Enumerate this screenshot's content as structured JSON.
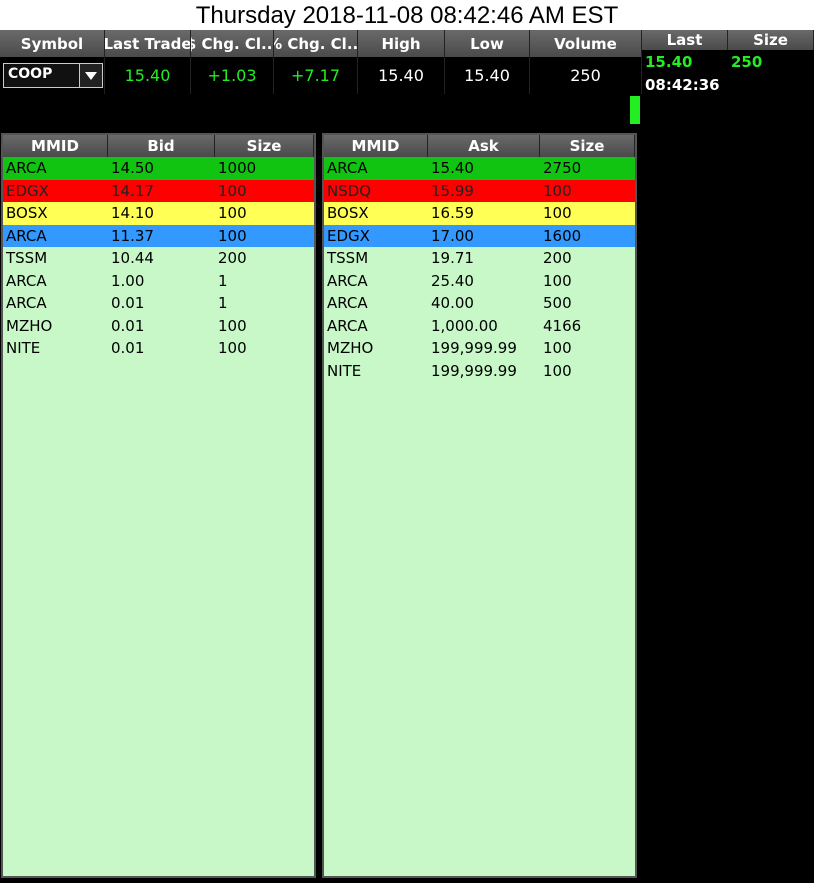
{
  "datetime": "Thursday 2018-11-08 08:42:46 AM EST",
  "quote": {
    "headers": [
      "Symbol",
      "Last Trade",
      "$ Chg. Cl...",
      "% Chg. Cl...",
      "High",
      "Low",
      "Volume"
    ],
    "symbol": "COOP",
    "last_trade": "15.40",
    "chg_dollar": "+1.03",
    "chg_pct": "+7.17",
    "high": "15.40",
    "low": "15.40",
    "volume": "250"
  },
  "time_sales": {
    "headers": [
      "Last",
      "Size"
    ],
    "last": "15.40",
    "size": "250",
    "time": "08:42:36"
  },
  "bid_book": {
    "headers": [
      "MMID",
      "Bid",
      "Size"
    ],
    "rows": [
      {
        "mmid": "ARCA",
        "price": "14.50",
        "size": "1000",
        "level": "lvl1"
      },
      {
        "mmid": "EDGX",
        "price": "14.17",
        "size": "100",
        "level": "lvl2"
      },
      {
        "mmid": "BOSX",
        "price": "14.10",
        "size": "100",
        "level": "lvl3"
      },
      {
        "mmid": "ARCA",
        "price": "11.37",
        "size": "100",
        "level": "lvl4"
      },
      {
        "mmid": "TSSM",
        "price": "10.44",
        "size": "200",
        "level": ""
      },
      {
        "mmid": "ARCA",
        "price": "1.00",
        "size": "1",
        "level": ""
      },
      {
        "mmid": "ARCA",
        "price": "0.01",
        "size": "1",
        "level": ""
      },
      {
        "mmid": "MZHO",
        "price": "0.01",
        "size": "100",
        "level": ""
      },
      {
        "mmid": "NITE",
        "price": "0.01",
        "size": "100",
        "level": ""
      }
    ]
  },
  "ask_book": {
    "headers": [
      "MMID",
      "Ask",
      "Size"
    ],
    "rows": [
      {
        "mmid": "ARCA",
        "price": "15.40",
        "size": "2750",
        "level": "lvl1"
      },
      {
        "mmid": "NSDQ",
        "price": "15.99",
        "size": "100",
        "level": "lvl2"
      },
      {
        "mmid": "BOSX",
        "price": "16.59",
        "size": "100",
        "level": "lvl3"
      },
      {
        "mmid": "EDGX",
        "price": "17.00",
        "size": "1600",
        "level": "lvl4"
      },
      {
        "mmid": "TSSM",
        "price": "19.71",
        "size": "200",
        "level": ""
      },
      {
        "mmid": "ARCA",
        "price": "25.40",
        "size": "100",
        "level": ""
      },
      {
        "mmid": "ARCA",
        "price": "40.00",
        "size": "500",
        "level": ""
      },
      {
        "mmid": "ARCA",
        "price": "1,000.00",
        "size": "4166",
        "level": ""
      },
      {
        "mmid": "MZHO",
        "price": "199,999.99",
        "size": "100",
        "level": ""
      },
      {
        "mmid": "NITE",
        "price": "199,999.99",
        "size": "100",
        "level": ""
      }
    ]
  },
  "colors": {
    "level1": "#11c411",
    "level2": "#ff0000",
    "level3": "#ffff55",
    "level4": "#3399ff",
    "book_bg": "#c8f8c8",
    "up_text": "#22ee22"
  },
  "icons": {
    "symbol_dropdown": "chevron-down-icon"
  }
}
